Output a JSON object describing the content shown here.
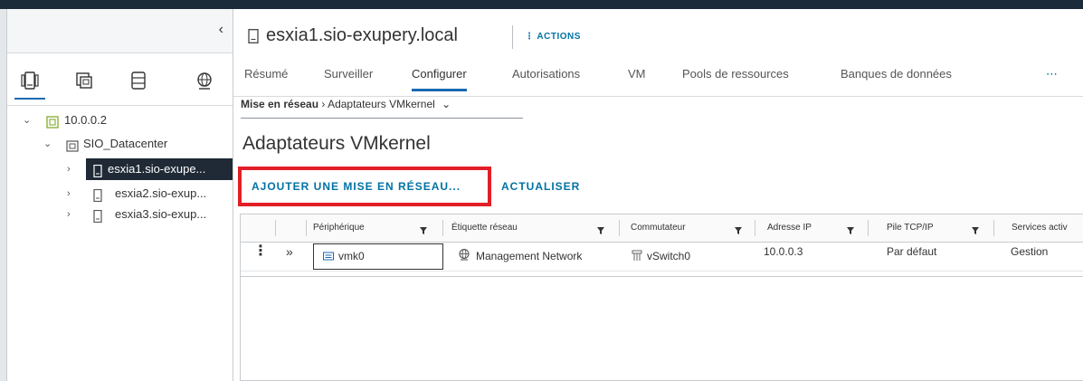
{
  "sidebar": {
    "collapse_glyph": "‹",
    "nav_icons": [
      "hosts-clusters-icon",
      "vms-templates-icon",
      "storage-icon",
      "networking-icon"
    ],
    "tree": [
      {
        "label": "10.0.0.2",
        "icon": "vcenter-icon",
        "expanded": true
      },
      {
        "label": "SIO_Datacenter",
        "icon": "datacenter-icon",
        "expanded": true
      },
      {
        "label": "esxia1.sio-exupe...",
        "icon": "host-icon",
        "selected": true
      },
      {
        "label": "esxia2.sio-exup...",
        "icon": "host-icon"
      },
      {
        "label": "esxia3.sio-exup...",
        "icon": "host-icon"
      }
    ]
  },
  "header": {
    "title": "esxia1.sio-exupery.local",
    "actions_label": "⋮ ACTIONS"
  },
  "tabs": [
    "Résumé",
    "Surveiller",
    "Configurer",
    "Autorisations",
    "VM",
    "Pools de ressources",
    "Banques de données",
    "⋯"
  ],
  "active_tab": "Configurer",
  "breadcrumb": {
    "parent": "Mise en réseau",
    "separator": "›",
    "current": "Adaptateurs VMkernel",
    "dropdown": "⌄"
  },
  "page_title": "Adaptateurs VMkernel",
  "toolbar": {
    "add_label": "AJOUTER UNE MISE EN RÉSEAU...",
    "refresh_label": "ACTUALISER"
  },
  "table": {
    "columns": [
      "Périphérique",
      "Étiquette réseau",
      "Commutateur",
      "Adresse IP",
      "Pile TCP/IP",
      "Services activ"
    ],
    "rows": [
      {
        "menu_glyph": "⋮",
        "expand_glyph": "»",
        "device": "vmk0",
        "network_label": "Management Network",
        "switch": "vSwitch0",
        "ip": "10.0.0.3",
        "tcpip_stack": "Par défaut",
        "services": "Gestion"
      }
    ]
  },
  "colors": {
    "accent": "#0072a3",
    "highlight_box": "#e21f26",
    "selected_bg": "#1f2a36",
    "tab_underline": "#1b69b1"
  }
}
